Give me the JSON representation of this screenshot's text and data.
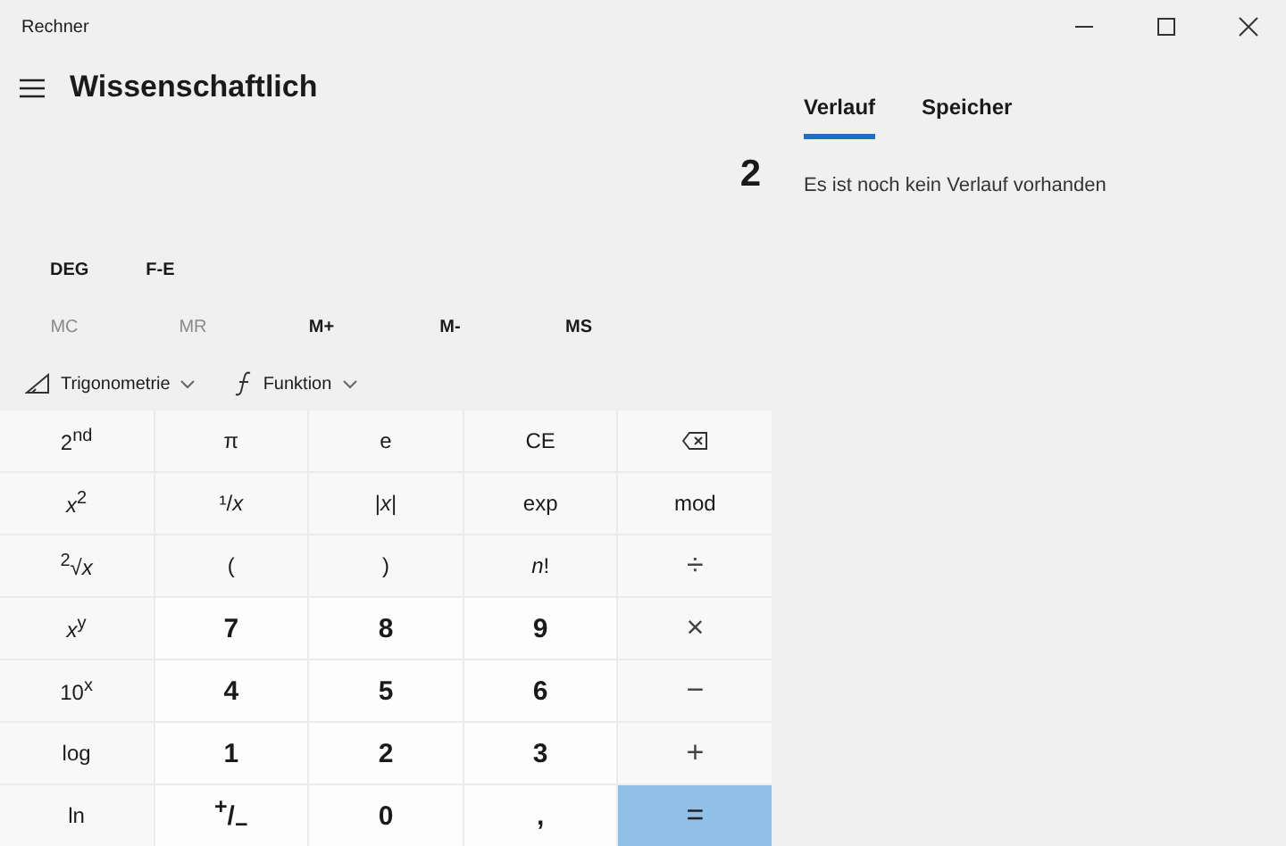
{
  "window": {
    "title": "Rechner"
  },
  "header": {
    "title": "Wissenschaftlich"
  },
  "display": {
    "value": "2"
  },
  "tabs": [
    {
      "label": "Verlauf",
      "selected": true
    },
    {
      "label": "Speicher",
      "selected": false
    }
  ],
  "history": {
    "empty_message": "Es ist noch kein Verlauf vorhanden"
  },
  "mode_buttons": [
    "DEG",
    "F-E"
  ],
  "memory_buttons": [
    {
      "label": "MC",
      "disabled": true
    },
    {
      "label": "MR",
      "disabled": true
    },
    {
      "label": "M+",
      "disabled": false
    },
    {
      "label": "M-",
      "disabled": false
    },
    {
      "label": "MS",
      "disabled": false
    }
  ],
  "dropdowns": [
    {
      "label": "Trigonometrie",
      "kind": "trig"
    },
    {
      "label": "Funktion",
      "kind": "func"
    }
  ],
  "keys": [
    {
      "label": "2$^{nd}$",
      "kind": "fn"
    },
    {
      "label": "π",
      "kind": "fn"
    },
    {
      "label": "e",
      "kind": "fn"
    },
    {
      "label": "CE",
      "kind": "fn"
    },
    {
      "kind": "backspace"
    },
    {
      "label": "*x*$^{2}$",
      "kind": "fn"
    },
    {
      "label": "¹/*x*",
      "kind": "fn"
    },
    {
      "label": "|*x*|",
      "kind": "fn"
    },
    {
      "label": "exp",
      "kind": "fn"
    },
    {
      "label": "mod",
      "kind": "fn"
    },
    {
      "label": "$^{2}$√*x*",
      "kind": "fn"
    },
    {
      "label": "(",
      "kind": "fn"
    },
    {
      "label": ")",
      "kind": "fn"
    },
    {
      "label": "*n*!",
      "kind": "fn"
    },
    {
      "label": "÷",
      "kind": "op"
    },
    {
      "label": "*x*$^{y}$",
      "kind": "fn"
    },
    {
      "label": "7",
      "kind": "num"
    },
    {
      "label": "8",
      "kind": "num"
    },
    {
      "label": "9",
      "kind": "num"
    },
    {
      "label": "×",
      "kind": "op"
    },
    {
      "label": "10$^{x}$",
      "kind": "fn"
    },
    {
      "label": "4",
      "kind": "num"
    },
    {
      "label": "5",
      "kind": "num"
    },
    {
      "label": "6",
      "kind": "num"
    },
    {
      "label": "−",
      "kind": "op"
    },
    {
      "label": "log",
      "kind": "fn"
    },
    {
      "label": "1",
      "kind": "num"
    },
    {
      "label": "2",
      "kind": "num"
    },
    {
      "label": "3",
      "kind": "num"
    },
    {
      "label": "+",
      "kind": "op"
    },
    {
      "label": "ln",
      "kind": "fn"
    },
    {
      "label": "$^{+}$/$_{−}$",
      "kind": "num"
    },
    {
      "label": "0",
      "kind": "num"
    },
    {
      "label": ",",
      "kind": "num"
    },
    {
      "label": "=",
      "kind": "equals"
    }
  ]
}
